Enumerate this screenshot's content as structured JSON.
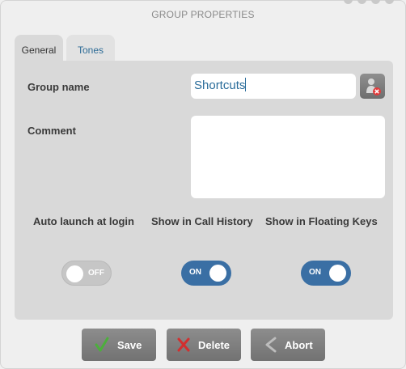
{
  "dialog": {
    "title": "GROUP PROPERTIES"
  },
  "tabs": [
    {
      "label": "General",
      "active": true
    },
    {
      "label": "Tones",
      "active": false
    }
  ],
  "form": {
    "group_name_label": "Group name",
    "group_name_value": "Shortcuts",
    "comment_label": "Comment",
    "comment_value": ""
  },
  "toggles": [
    {
      "label": "Auto launch at login",
      "state": "OFF"
    },
    {
      "label": "Show in Call History",
      "state": "ON"
    },
    {
      "label": "Show in Floating Keys",
      "state": "ON"
    }
  ],
  "buttons": {
    "save": "Save",
    "delete": "Delete",
    "abort": "Abort"
  },
  "colors": {
    "accent": "#3a6fa4",
    "tab_link": "#2d6b96",
    "save_check": "#4caf3c",
    "delete_x": "#d22f2f"
  }
}
